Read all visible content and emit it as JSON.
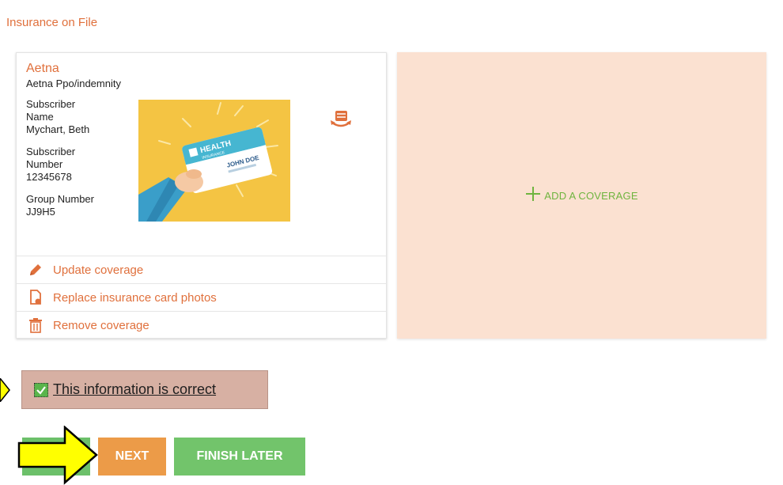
{
  "section_title": "Insurance on File",
  "coverage": {
    "payer": "Aetna",
    "plan": "Aetna Ppo/indemnity",
    "subscriber_name_label": "Subscriber Name",
    "subscriber_name": "Mychart, Beth",
    "subscriber_number_label": "Subscriber Number",
    "subscriber_number": "12345678",
    "group_number_label": "Group Number",
    "group_number": "JJ9H5",
    "card_image": {
      "brand_line1": "HEALTH",
      "brand_line2": "INSURANCE",
      "holder_name": "JOHN DOE"
    },
    "actions": {
      "update": "Update coverage",
      "replace_photos": "Replace insurance card photos",
      "remove": "Remove coverage"
    }
  },
  "add_coverage_label": "ADD A COVERAGE",
  "confirm_label": "This information is correct",
  "buttons": {
    "next": "NEXT",
    "finish_later": "FINISH LATER"
  },
  "colors": {
    "accent_orange": "#e0703c",
    "add_coverage_bg": "#fbe1d1",
    "green": "#72c46b",
    "next_orange": "#ec9b48",
    "annotation_arrow": "#ffff00"
  }
}
